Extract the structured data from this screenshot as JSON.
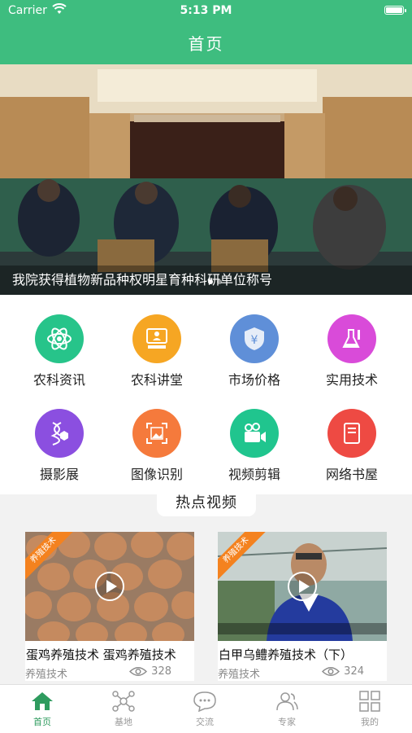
{
  "status_bar": {
    "carrier": "Carrier",
    "time": "5:13 PM"
  },
  "nav": {
    "title": "首页"
  },
  "banner": {
    "caption": "我院获得植物新品种权明星育种科研单位称号"
  },
  "menu": [
    {
      "label": "农科资讯",
      "icon": "atom-icon",
      "color": "#27c48a"
    },
    {
      "label": "农科讲堂",
      "icon": "lecture-icon",
      "color": "#f6a623"
    },
    {
      "label": "市场价格",
      "icon": "price-shield-icon",
      "color": "#5f8fd8"
    },
    {
      "label": "实用技术",
      "icon": "flask-icon",
      "color": "#d94bd9"
    },
    {
      "label": "摄影展",
      "icon": "dna-icon",
      "color": "#8b4fe0"
    },
    {
      "label": "图像识别",
      "icon": "image-scan-icon",
      "color": "#f57a3c"
    },
    {
      "label": "视频剪辑",
      "icon": "video-camera-icon",
      "color": "#20c58e"
    },
    {
      "label": "网络书屋",
      "icon": "book-icon",
      "color": "#ee4a43"
    }
  ],
  "hot_videos": {
    "section_title": "热点视频",
    "items": [
      {
        "ribbon": "养殖技术",
        "title": "蛋鸡养殖技术  蛋鸡养殖技术",
        "category": "养殖技术",
        "views": "328"
      },
      {
        "ribbon": "养殖技术",
        "title": "白甲乌鳢养殖技术（下）",
        "category": "养殖技术",
        "views": "324"
      }
    ]
  },
  "tabbar": [
    {
      "label": "首页",
      "icon": "home-icon",
      "active": true
    },
    {
      "label": "基地",
      "icon": "network-icon",
      "active": false
    },
    {
      "label": "交流",
      "icon": "chat-icon",
      "active": false
    },
    {
      "label": "专家",
      "icon": "people-icon",
      "active": false
    },
    {
      "label": "我的",
      "icon": "grid-icon",
      "active": false
    }
  ],
  "colors": {
    "primary": "#3ebd7f",
    "tab_active": "#2e9b5e",
    "ribbon": "#f4821f"
  }
}
